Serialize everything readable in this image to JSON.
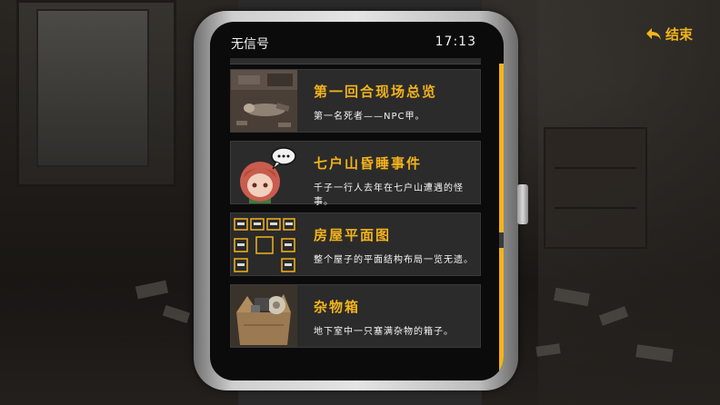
{
  "exit_button": {
    "label": "结束",
    "icon": "back-arrow-icon"
  },
  "watch": {
    "signal_text": "无信号",
    "time": "17:13"
  },
  "scroll": {
    "position": 0.55,
    "visible_fraction": 0.14
  },
  "cards": [
    {
      "title": "第一回合现场总览",
      "desc": "第一名死者——NPC甲。",
      "thumb": "crime-scene-photo"
    },
    {
      "title": "七户山昏睡事件",
      "desc": "千子一行人去年在七户山遭遇的怪事。",
      "thumb": "character-portrait"
    },
    {
      "title": "房屋平面图",
      "desc": "整个屋子的平面结构布局一览无遗。",
      "thumb": "floor-plan"
    },
    {
      "title": "杂物箱",
      "desc": "地下室中一只塞满杂物的箱子。",
      "thumb": "cardboard-box"
    }
  ],
  "colors": {
    "accent": "#f2b31c",
    "card_bg": "#2b2b2b",
    "screen_bg": "#0b0b0b"
  }
}
